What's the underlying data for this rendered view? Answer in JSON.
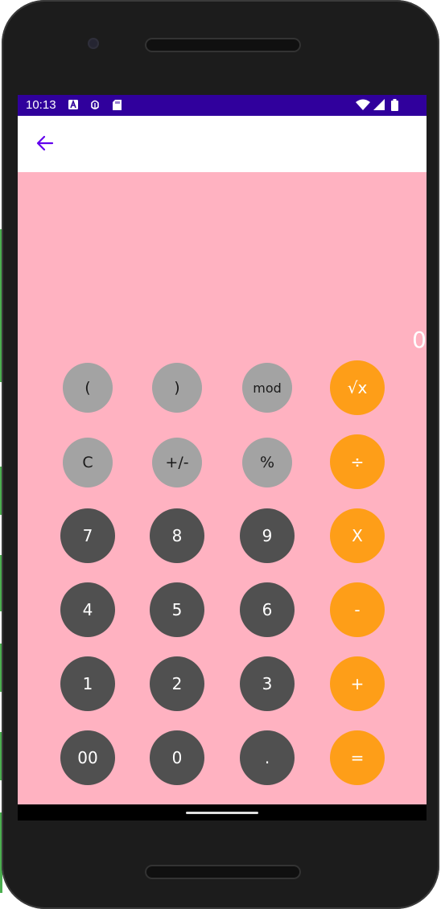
{
  "status_bar": {
    "time": "10:13",
    "left_icons": [
      "a-notification-icon",
      "bug-icon",
      "sd-card-icon"
    ],
    "right_icons": [
      "wifi-icon",
      "signal-icon",
      "battery-icon"
    ]
  },
  "app_bar": {
    "back_icon": "arrow-back-icon"
  },
  "display": {
    "value": "0"
  },
  "keypad": {
    "row1": [
      "(",
      ")",
      "mod",
      "√x"
    ],
    "row2": [
      "C",
      "+/-",
      "%",
      "÷"
    ],
    "row3": [
      "7",
      "8",
      "9",
      "X"
    ],
    "row4": [
      "4",
      "5",
      "6",
      "-"
    ],
    "row5": [
      "1",
      "2",
      "3",
      "+"
    ],
    "row6": [
      "00",
      "0",
      ".",
      "="
    ]
  },
  "colors": {
    "status_bar": "#30009c",
    "background": "#ffb2c1",
    "function_key": "#a3a3a3",
    "digit_key": "#505050",
    "operator_key": "#fe9e18",
    "accent": "#6200ee"
  }
}
